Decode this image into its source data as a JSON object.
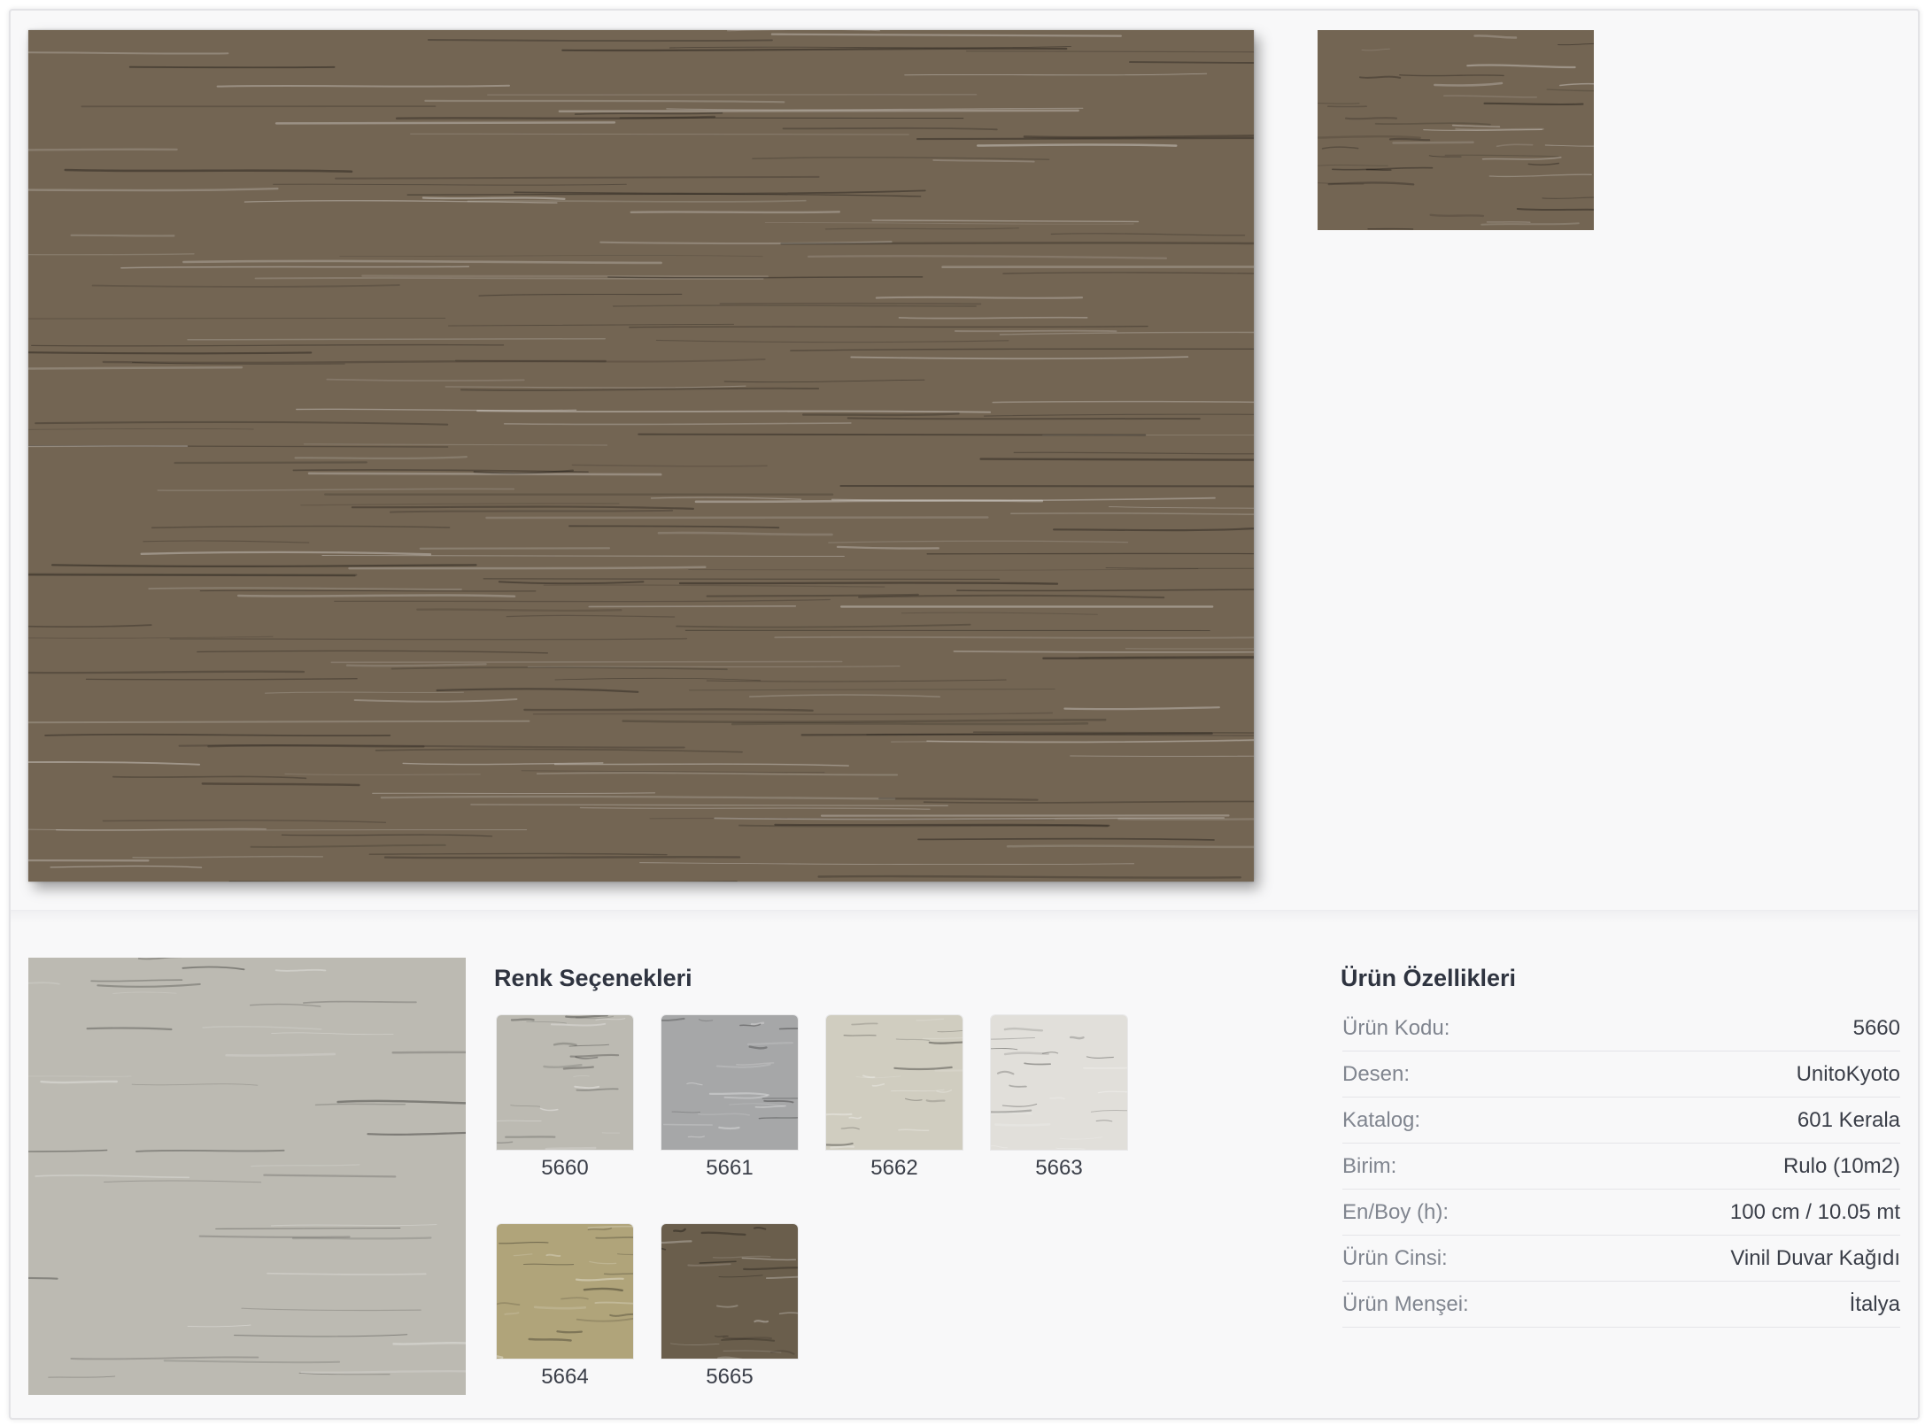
{
  "sections": {
    "colors_title": "Renk Seçenekleri",
    "specs_title": "Ürün Özellikleri"
  },
  "images": {
    "main_color": "#736553",
    "thumb_color": "#736553",
    "preview_color": "#bcbab2"
  },
  "swatches": [
    {
      "code": "5660",
      "color": "#bcbab2"
    },
    {
      "code": "5661",
      "color": "#a6a7a8"
    },
    {
      "code": "5662",
      "color": "#d0cdc0"
    },
    {
      "code": "5663",
      "color": "#e1dfda"
    },
    {
      "code": "5664",
      "color": "#b0a47a"
    },
    {
      "code": "5665",
      "color": "#6a5e4c"
    }
  ],
  "specs": [
    {
      "key": "Ürün Kodu:",
      "value": "5660"
    },
    {
      "key": "Desen:",
      "value": "UnitoKyoto"
    },
    {
      "key": "Katalog:",
      "value": "601 Kerala"
    },
    {
      "key": "Birim:",
      "value": "Rulo (10m2)"
    },
    {
      "key": "En/Boy (h):",
      "value": "100 cm / 10.05 mt"
    },
    {
      "key": "Ürün Cinsi:",
      "value": "Vinil Duvar Kağıdı"
    },
    {
      "key": "Ürün Menşei:",
      "value": "İtalya"
    }
  ]
}
